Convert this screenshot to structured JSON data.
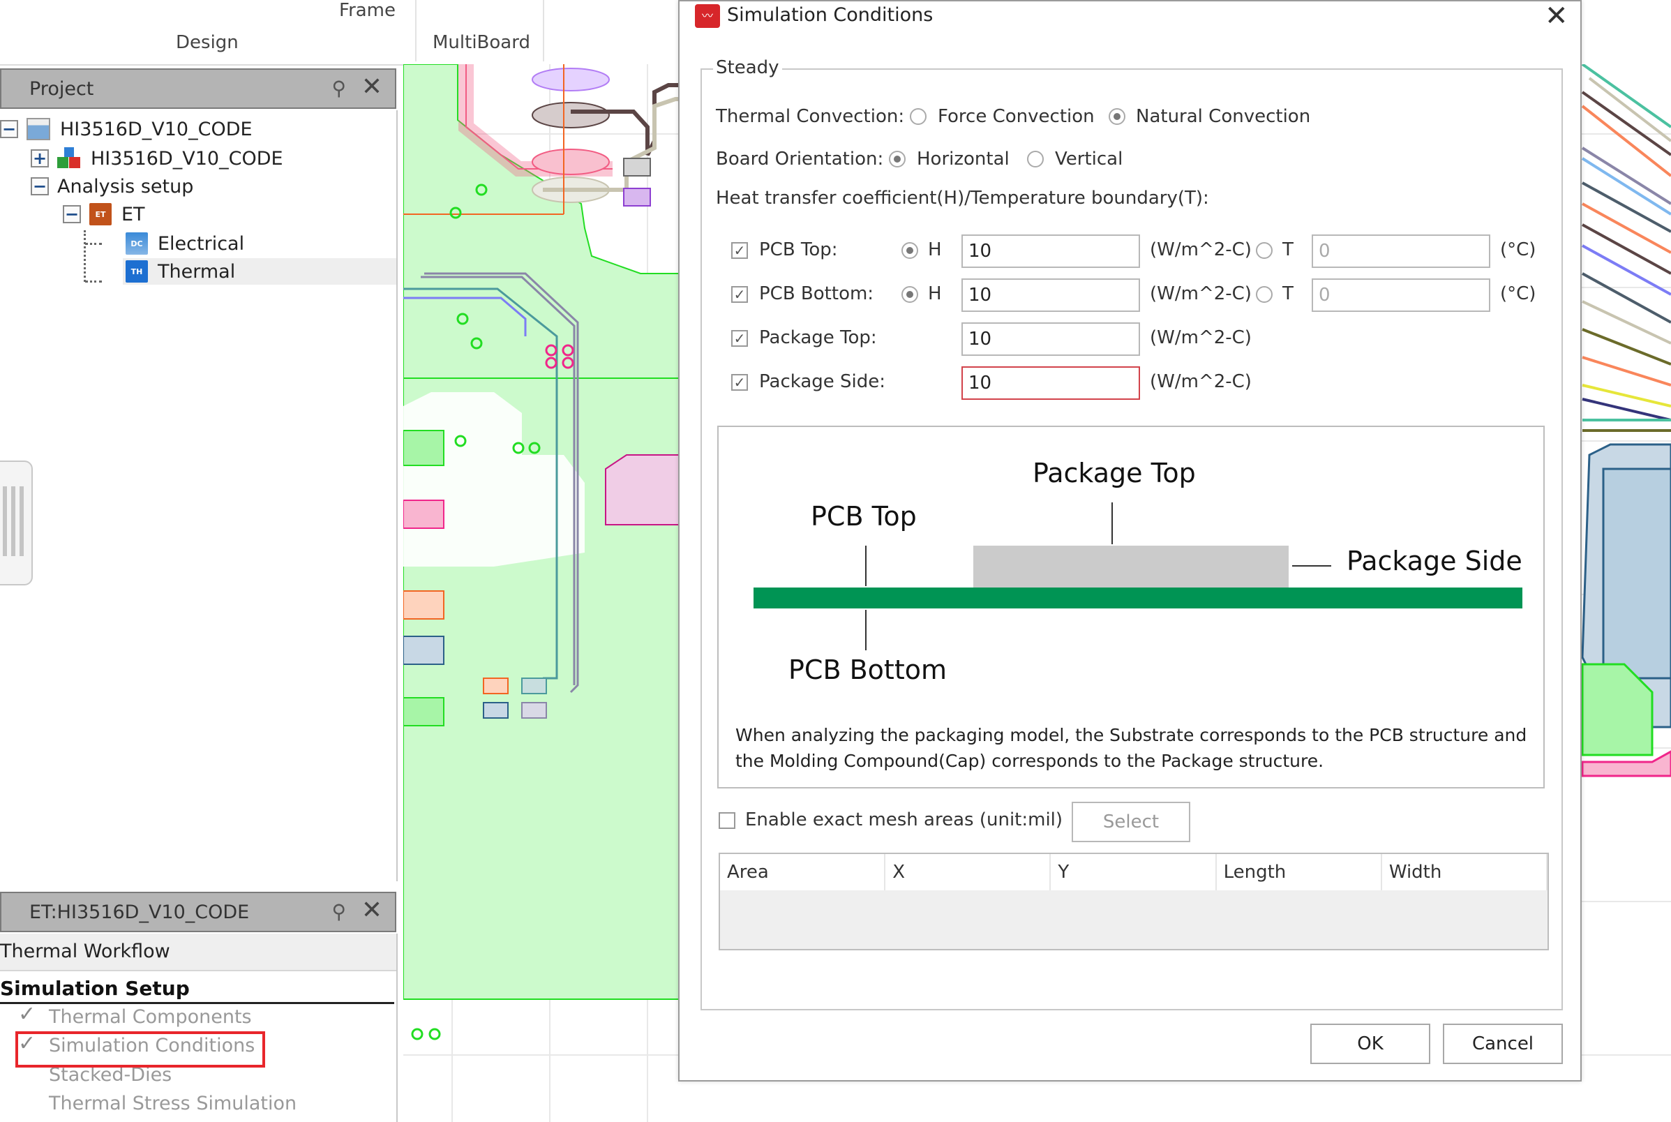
{
  "ribbon": {
    "groups": [
      {
        "label": "Frame"
      },
      {
        "label": "Design"
      },
      {
        "label": "MultiBoard"
      }
    ]
  },
  "project_panel": {
    "title": "Project",
    "pin_icon": "pin-icon",
    "close_icon": "close-icon",
    "tree": [
      {
        "label": "HI3516D_V10_CODE",
        "icon": "project-window-icon",
        "expander": "−"
      },
      {
        "label": "HI3516D_V10_CODE",
        "icon": "design-blocks-icon",
        "expander": "+"
      },
      {
        "label": "Analysis setup",
        "expander": "−"
      },
      {
        "label": "ET",
        "badge": "ET",
        "expander": "−"
      },
      {
        "label": "Electrical",
        "badge": "DC"
      },
      {
        "label": "Thermal",
        "badge": "TH",
        "selected": true
      }
    ]
  },
  "workflow_panel": {
    "title": "ET:HI3516D_V10_CODE",
    "workflow_title": "Thermal Workflow",
    "section": "Simulation Setup",
    "items": [
      {
        "label": "Thermal Components",
        "checked": true
      },
      {
        "label": "Simulation Conditions",
        "checked": true,
        "highlighted": true
      },
      {
        "label": "Stacked-Dies",
        "checked": false
      },
      {
        "label": "Thermal Stress Simulation",
        "checked": false
      }
    ]
  },
  "dialog": {
    "title": "Simulation Conditions",
    "close_glyph": "✕",
    "group_label": "Steady",
    "thermal_convection": {
      "label": "Thermal Convection:",
      "options": [
        "Force Convection",
        "Natural Convection"
      ],
      "selected": "Natural Convection"
    },
    "board_orientation": {
      "label": "Board Orientation:",
      "options": [
        "Horizontal",
        "Vertical"
      ],
      "selected": "Horizontal"
    },
    "heat_transfer_label": "Heat transfer coefficient(H)/Temperature boundary(T):",
    "rows": [
      {
        "label": "PCB Top:",
        "checked": true,
        "h_radio": "H",
        "h_selected": true,
        "h_value": "10",
        "h_unit": "(W/m^2-C)",
        "t_radio": "T",
        "t_value": "0",
        "t_unit": "(°C)"
      },
      {
        "label": "PCB Bottom:",
        "checked": true,
        "h_radio": "H",
        "h_selected": true,
        "h_value": "10",
        "h_unit": "(W/m^2-C)",
        "t_radio": "T",
        "t_value": "0",
        "t_unit": "(°C)"
      },
      {
        "label": "Package Top:",
        "checked": true,
        "h_value": "10",
        "h_unit": "(W/m^2-C)"
      },
      {
        "label": "Package Side:",
        "checked": true,
        "h_value": "10",
        "h_unit": "(W/m^2-C)",
        "error": true
      }
    ],
    "diagram": {
      "labels": {
        "package_top": "Package Top",
        "pcb_top": "PCB Top",
        "package_side": "Package Side",
        "pcb_bottom": "PCB Bottom"
      },
      "note": "When analyzing the packaging model, the Substrate corresponds to the PCB structure and the Molding Compound(Cap) corresponds to the Package structure."
    },
    "mesh": {
      "checkbox_label": "Enable exact mesh areas (unit:mil)",
      "checked": false,
      "select_button": "Select",
      "columns": [
        "Area",
        "X",
        "Y",
        "Length",
        "Width"
      ],
      "rows": []
    },
    "buttons": {
      "ok": "OK",
      "cancel": "Cancel"
    }
  },
  "colors": {
    "pcb_green": "#009454",
    "package_gray": "#cbcbcb",
    "highlight_red": "#e8262b",
    "error_border": "#d2434b",
    "copper_fill": "#ccfacc"
  }
}
